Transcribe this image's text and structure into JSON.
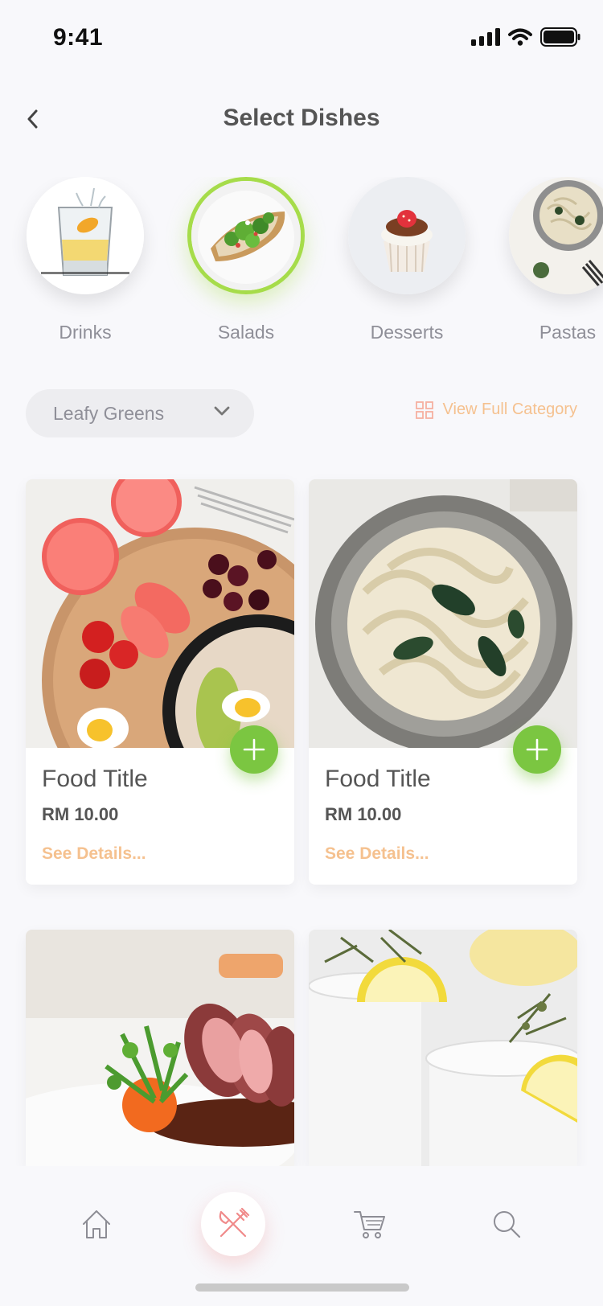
{
  "status_bar": {
    "time": "9:41"
  },
  "header": {
    "title": "Select Dishes"
  },
  "categories": [
    {
      "label": "Drinks",
      "active": false
    },
    {
      "label": "Salads",
      "active": true
    },
    {
      "label": "Desserts",
      "active": false
    },
    {
      "label": "Pastas",
      "active": false
    }
  ],
  "filter": {
    "dropdown_value": "Leafy Greens",
    "view_full_label": "View Full Category"
  },
  "cards": [
    {
      "title": "Food Title",
      "price": "RM 10.00",
      "details": "See Details..."
    },
    {
      "title": "Food Title",
      "price": "RM 10.00",
      "details": "See Details..."
    }
  ],
  "bottom_nav": {
    "items": [
      "home-icon",
      "utensils-icon",
      "cart-icon",
      "search-icon"
    ],
    "active": "utensils-icon"
  },
  "colors": {
    "accent_green": "#7bc641",
    "active_ring": "#a6dc4a",
    "link_orange": "#f5c18f",
    "nav_active_icon": "#f08a8a"
  }
}
